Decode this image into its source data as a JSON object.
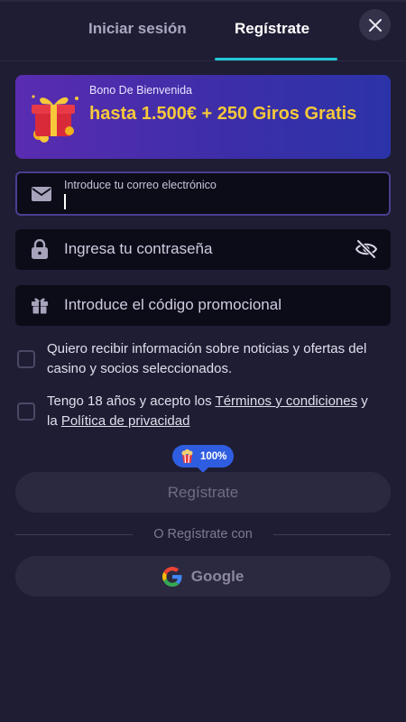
{
  "tabs": [
    {
      "label": "Iniciar sesión",
      "active": false
    },
    {
      "label": "Regístrate",
      "active": true
    }
  ],
  "banner": {
    "subtitle": "Bono De Bienvenida",
    "title": "hasta 1.500€ + 250 Giros Gratis",
    "icon": "gift-box-icon"
  },
  "form": {
    "email": {
      "label": "Introduce tu correo electrónico",
      "value": "",
      "icon": "mail-icon"
    },
    "password": {
      "placeholder": "Ingresa tu contraseña",
      "icon": "lock-icon",
      "toggle_icon": "eye-off-icon"
    },
    "promo": {
      "placeholder": "Introduce el código promocional",
      "icon": "gift-icon"
    }
  },
  "consents": {
    "news": {
      "checked": false,
      "text": "Quiero recibir información sobre noticias y ofertas del casino y socios seleccionados."
    },
    "terms": {
      "checked": false,
      "prefix": "Tengo 18 años y acepto los ",
      "terms_link": "Términos y condiciones",
      "middle": " y la ",
      "privacy_link": "Política de privacidad"
    }
  },
  "progress_badge": {
    "value": "100%",
    "icon": "popcorn-icon"
  },
  "register_button": "Regístrate",
  "divider_text": "O Regístrate con",
  "google_button": "Google",
  "colors": {
    "background": "#1f1d33",
    "accent": "#22c6d8",
    "banner_text": "#f6c83a",
    "badge": "#2f5de0"
  }
}
